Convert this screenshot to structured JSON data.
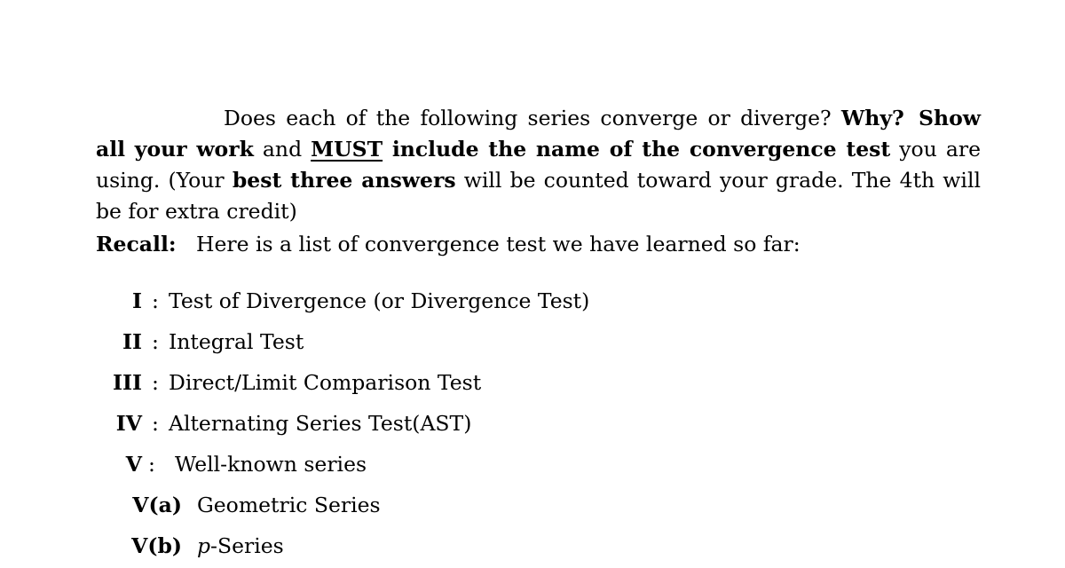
{
  "document": {
    "intro": {
      "seg1": "Does each of the following series converge or diverge? ",
      "seg2_bold": "Why?",
      "seg3_bold": "Show all your work",
      "seg4": " and ",
      "seg5_bold_underline": "MUST",
      "seg6_bold": " include the name of the convergence test",
      "seg7": " you are using. (Your ",
      "seg8_bold": "best three answers",
      "seg9": " will be counted toward your grade. The 4th will be for extra credit)"
    },
    "recall": {
      "label": "Recall:",
      "text": "Here is a list of convergence test we have learned so far:"
    },
    "list": [
      {
        "numeral": "I",
        "separator": ":",
        "text": "Test of Divergence (or Divergence Test)"
      },
      {
        "numeral": "II",
        "separator": ":",
        "text": "Integral Test"
      },
      {
        "numeral": "III",
        "separator": ":",
        "text": "Direct/Limit Comparison Test"
      },
      {
        "numeral": "IV",
        "separator": ":",
        "text": "Alternating Series Test(AST)"
      },
      {
        "numeral": "V",
        "separator": ":",
        "text": "Well-known series"
      }
    ],
    "sublist": [
      {
        "label": "V(a)",
        "text": "Geometric Series",
        "italic_prefix": ""
      },
      {
        "label": "V(b)",
        "text": "-Series",
        "italic_prefix": "p"
      }
    ]
  },
  "colors": {
    "page_background": "#ffffff",
    "text": "#000000"
  }
}
